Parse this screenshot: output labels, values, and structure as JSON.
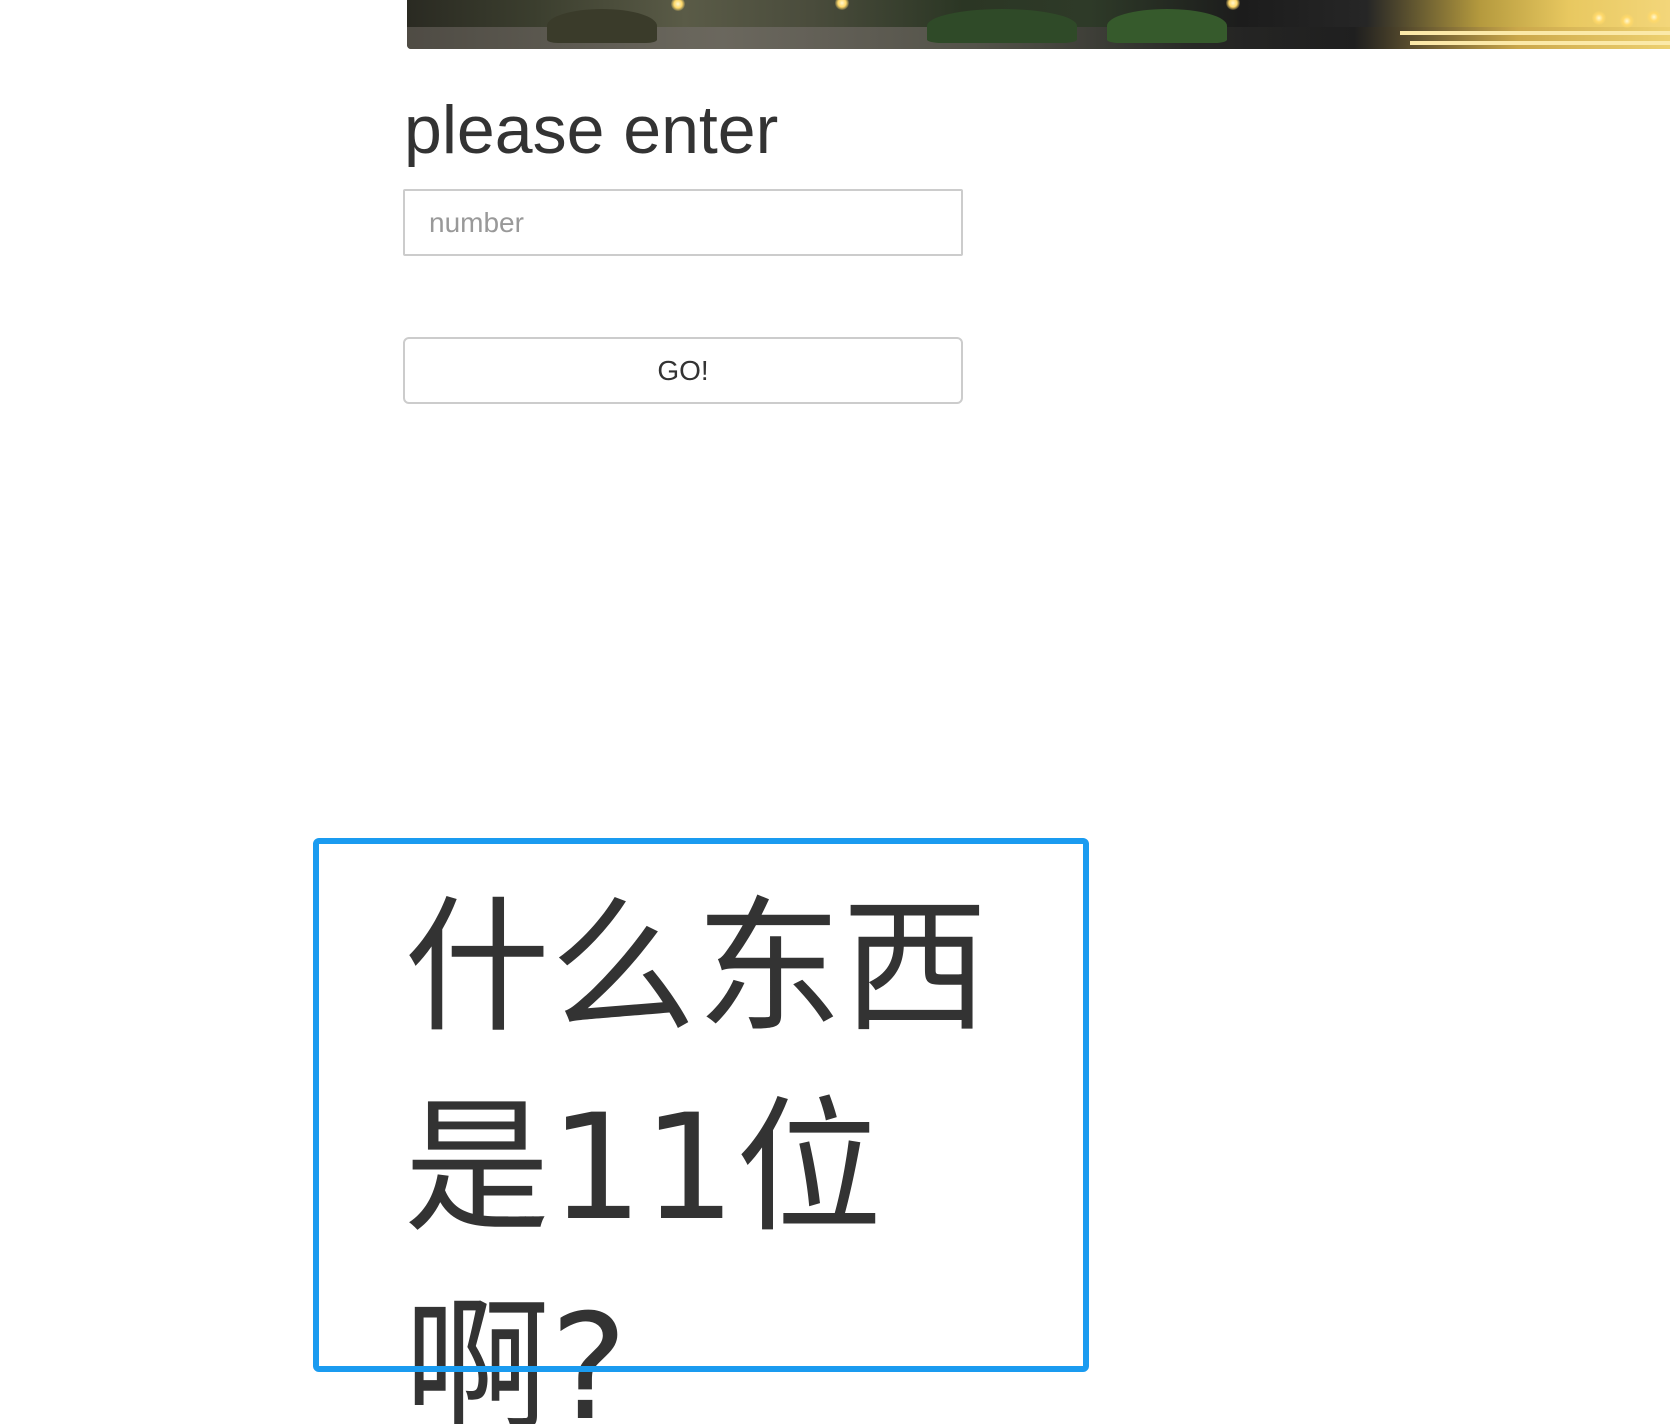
{
  "form": {
    "heading": "please enter",
    "input_placeholder": "number",
    "input_value": "",
    "submit_label": "GO!"
  },
  "question": {
    "text": "什么东西是11位啊?"
  },
  "colors": {
    "text": "#333333",
    "border": "#cccccc",
    "selection": "#1a9bf0"
  }
}
